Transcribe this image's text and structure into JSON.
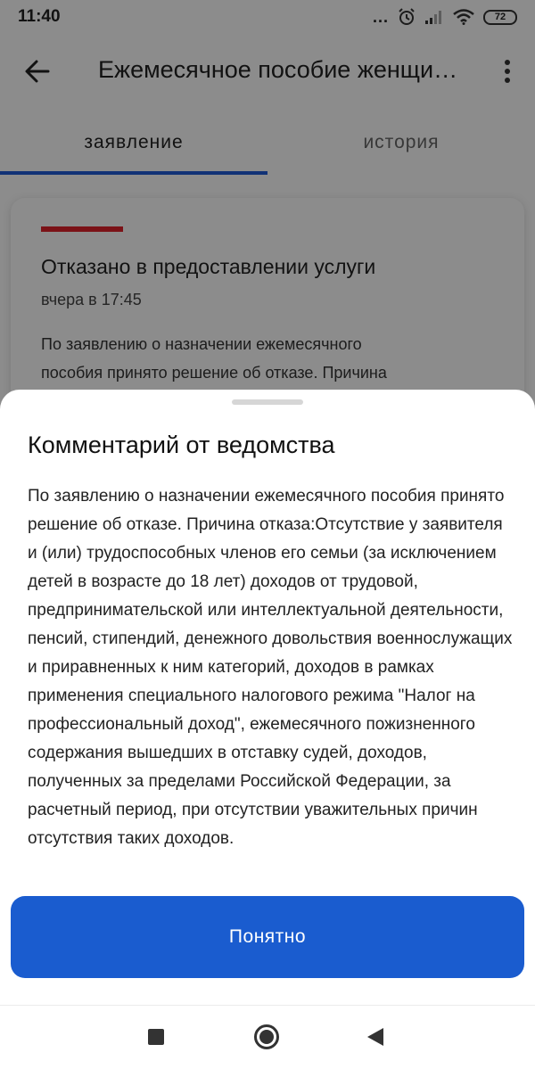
{
  "status_bar": {
    "time": "11:40",
    "dots": "...",
    "battery": "72"
  },
  "app_bar": {
    "title": "Ежемесячное пособие женщинам"
  },
  "tabs": [
    {
      "label": "заявление",
      "active": true
    },
    {
      "label": "история",
      "active": false
    }
  ],
  "card": {
    "title": "Отказано в предоставлении услуги",
    "time": "вчера в 17:45",
    "preview": "По заявлению о назначении ежемесячного пособия принято решение об отказе. Причина"
  },
  "sheet": {
    "title": "Комментарий от ведомства",
    "text": "По заявлению о назначении ежемесячного пособия принято решение об отказе. Причина отказа:Отсутствие у заявителя и (или) трудоспособных членов его семьи (за исключением детей в возрасте до 18 лет) доходов от трудовой, предпринимательской или интеллектуальной деятельности, пенсий, стипендий, денежного довольствия военнослужащих и приравненных к ним категорий, доходов в рамках применения специального налогового режима \"Налог на профессиональный доход\", ежемесячного пожизненного содержания вышедших в отставку судей, доходов, полученных за пределами Российской Федерации, за расчетный период, при отсутствии уважительных причин отсутствия таких доходов.",
    "button_label": "Понятно"
  },
  "colors": {
    "accent": "#1a5ccf",
    "tab_indicator": "#1f5bd8",
    "status_red": "#e1222a"
  },
  "icons": {
    "back": "arrow-left-icon",
    "menu": "more-vertical-icon",
    "alarm": "alarm-icon",
    "signal": "signal-icon",
    "wifi": "wifi-icon",
    "battery": "battery-icon"
  }
}
